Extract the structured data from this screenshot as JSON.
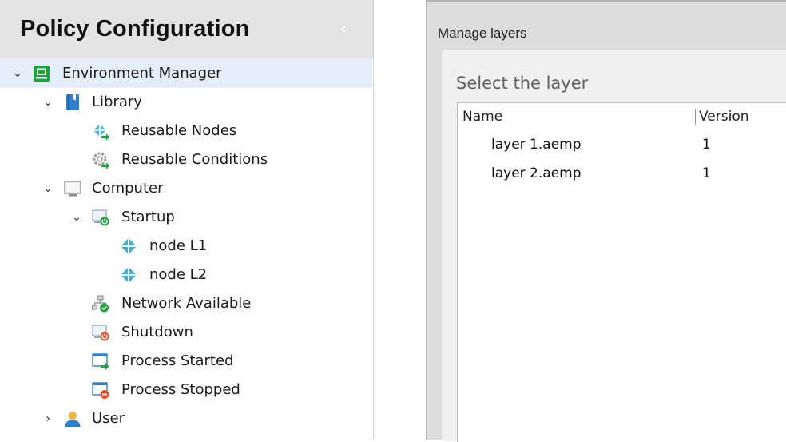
{
  "policy_panel": {
    "title": "Policy Configuration",
    "collapse_glyph": "‹",
    "tree": [
      {
        "id": "environment-manager",
        "label": "Environment Manager",
        "icon": "environment-manager-icon",
        "expander": "expanded",
        "selected": true
      },
      {
        "id": "library",
        "label": "Library",
        "icon": "library-book-icon",
        "expander": "expanded"
      },
      {
        "id": "reusable-nodes",
        "label": "Reusable Nodes",
        "icon": "reusable-nodes-icon",
        "expander": "none"
      },
      {
        "id": "reusable-conditions",
        "label": "Reusable Conditions",
        "icon": "reusable-conditions-icon",
        "expander": "none"
      },
      {
        "id": "computer",
        "label": "Computer",
        "icon": "computer-monitor-icon",
        "expander": "expanded"
      },
      {
        "id": "startup",
        "label": "Startup",
        "icon": "startup-icon",
        "expander": "expanded"
      },
      {
        "id": "node-l1",
        "label": "node L1",
        "icon": "node-icon",
        "expander": "none"
      },
      {
        "id": "node-l2",
        "label": "node L2",
        "icon": "node-icon",
        "expander": "none"
      },
      {
        "id": "network-available",
        "label": "Network Available",
        "icon": "network-available-icon",
        "expander": "none"
      },
      {
        "id": "shutdown",
        "label": "Shutdown",
        "icon": "shutdown-icon",
        "expander": "none"
      },
      {
        "id": "process-started",
        "label": "Process Started",
        "icon": "process-started-icon",
        "expander": "none"
      },
      {
        "id": "process-stopped",
        "label": "Process Stopped",
        "icon": "process-stopped-icon",
        "expander": "none"
      },
      {
        "id": "user",
        "label": "User",
        "icon": "user-icon",
        "expander": "collapsed"
      }
    ],
    "colors": {
      "header_bg": "#e3e3e3",
      "selected_row_bg": "#e5eef8",
      "green_accent": "#1aa53b"
    }
  },
  "manage_layers": {
    "title": "Manage layers",
    "prompt": "Select the layer",
    "columns": {
      "name": "Name",
      "version": "Version"
    },
    "rows": [
      {
        "name": "layer 1.aemp",
        "version": "1"
      },
      {
        "name": "layer 2.aemp",
        "version": "1"
      }
    ],
    "colors": {
      "dialog_bg": "#dcdcdc",
      "body_bg": "#f0f0f0",
      "list_bg": "#ffffff"
    }
  }
}
